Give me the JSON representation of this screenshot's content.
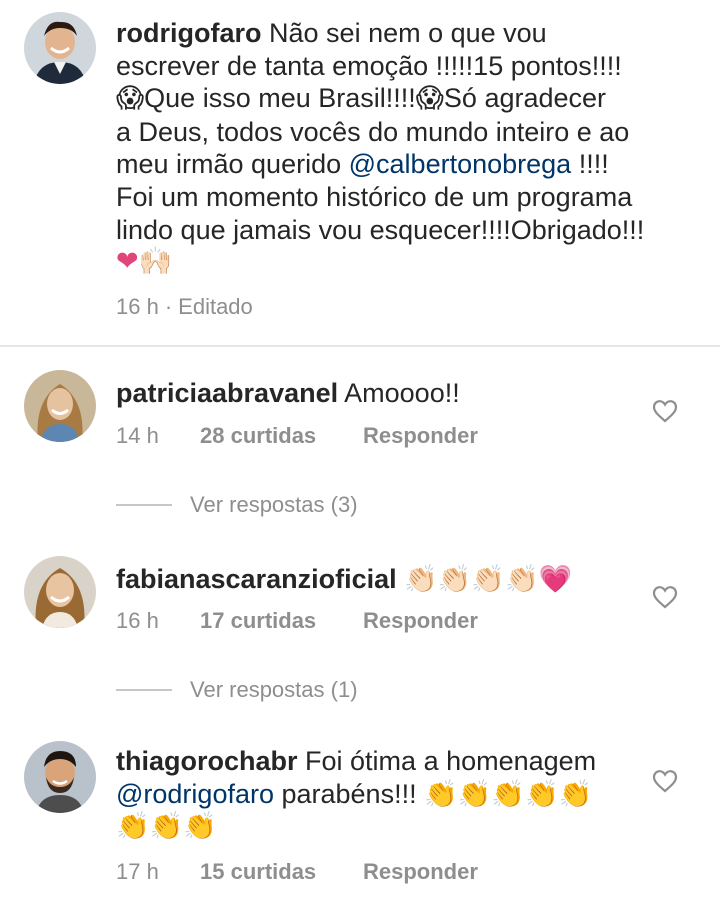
{
  "caption": {
    "username": "rodrigofaro",
    "line1": "Não sei  nem o que vou",
    "line2": "escrever de tanta emoção !!!!!15 pontos!!!!",
    "line3_emoji_a": "😱",
    "line3_text_a": "Que isso meu Brasil!!!!",
    "line3_emoji_b": "😱",
    "line3_text_b": "Só agradecer",
    "line4": "a Deus, todos vocês do mundo inteiro e ao",
    "line5_text": "meu irmão querido ",
    "line5_mention": "@calbertonobrega",
    "line5_end": " !!!!",
    "line6": "Foi um momento histórico de um programa",
    "line7": "lindo que jamais vou esquecer!!!!Obrigado!!!",
    "line8_emoji": "❤🙌🏻",
    "time": "16 h",
    "separator": "·",
    "edited": "Editado"
  },
  "comments": [
    {
      "username": "patriciaabravanel",
      "text": "Amoooo!!",
      "time": "14 h",
      "likes": "28 curtidas",
      "reply": "Responder",
      "view_replies": "Ver respostas (3)"
    },
    {
      "username": "fabianascaranzioficial",
      "text": "👏🏻👏🏻👏🏻👏🏻💗",
      "time": "16 h",
      "likes": "17 curtidas",
      "reply": "Responder",
      "view_replies": "Ver respostas (1)"
    },
    {
      "username": "thiagorochabr",
      "text_a": "Foi ótima a homenagem",
      "mention": "@rodrigofaro",
      "text_b": " parabéns!!! ",
      "emoji_a": "👏👏👏👏👏",
      "emoji_b": "👏👏👏",
      "time": "17 h",
      "likes": "15 curtidas",
      "reply": "Responder"
    }
  ],
  "colors": {
    "text": "#262626",
    "secondary": "#8e8e8e",
    "mention": "#003569",
    "divider": "#e6e6e6"
  },
  "icons": [
    "heart-outline-icon"
  ]
}
